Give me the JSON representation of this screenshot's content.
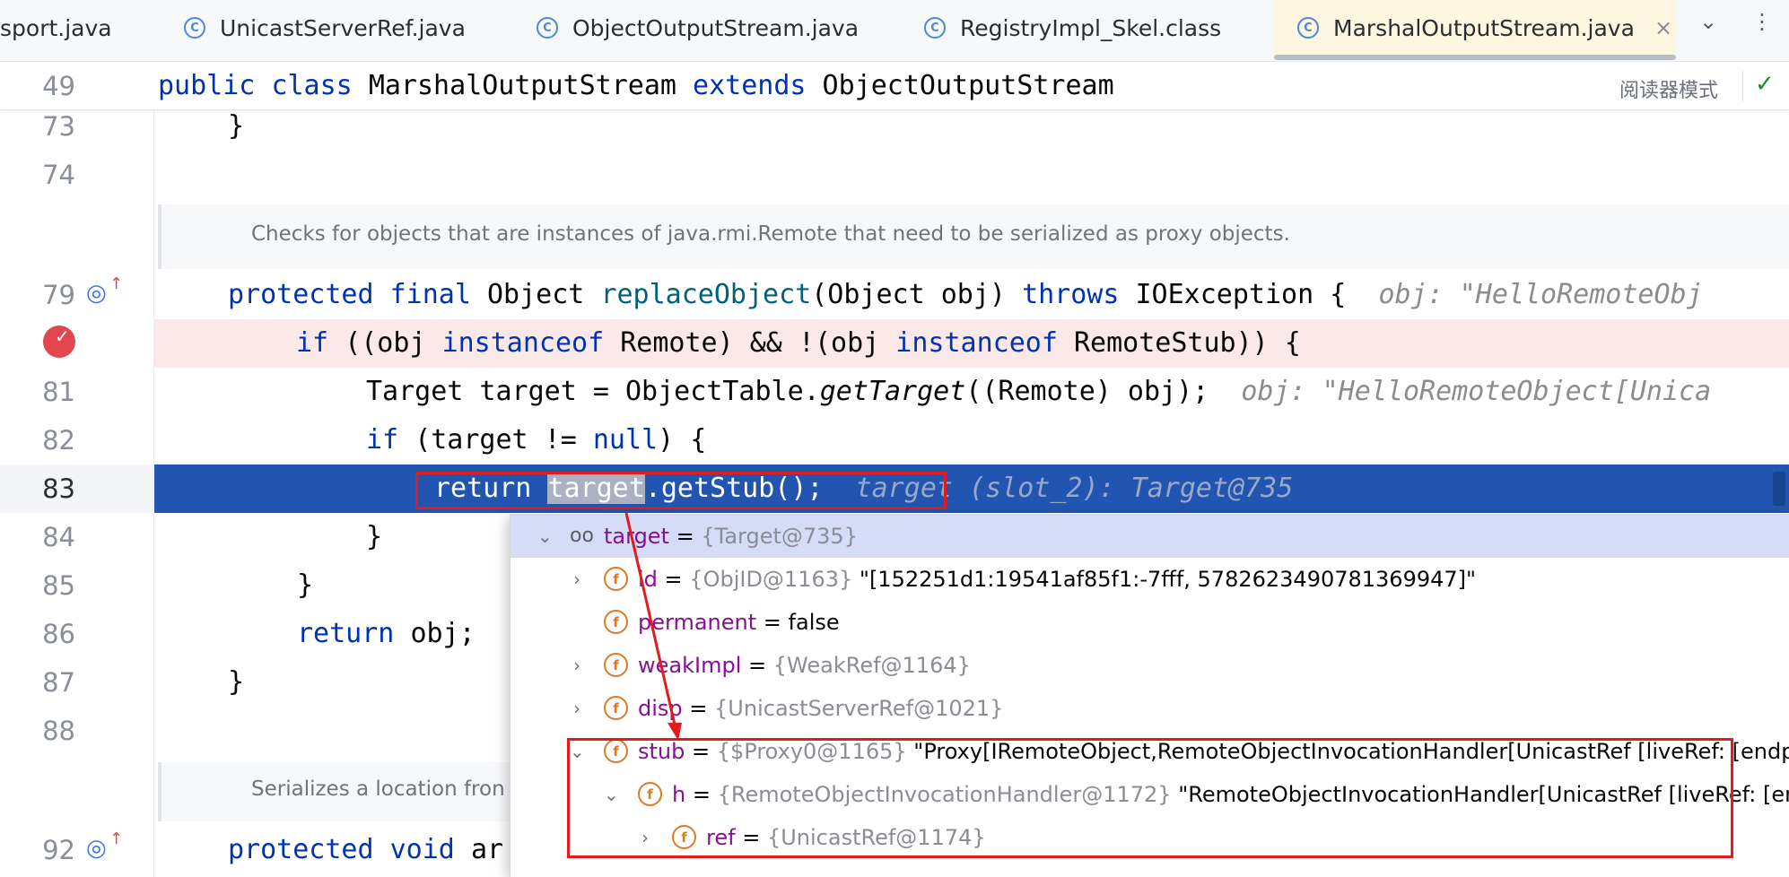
{
  "tabs": [
    {
      "label": "sport.java",
      "icon": "class-icon"
    },
    {
      "label": "UnicastServerRef.java",
      "icon": "class-icon"
    },
    {
      "label": "ObjectOutputStream.java",
      "icon": "class-icon"
    },
    {
      "label": "RegistryImpl_Skel.class",
      "icon": "class-icon"
    },
    {
      "label": "MarshalOutputStream.java",
      "icon": "class-icon",
      "active": true
    }
  ],
  "tab_close": "×",
  "reader_mode": "阅读器模式",
  "sticky": {
    "line": "49",
    "kw1": "public",
    "kw2": "class",
    "name": "MarshalOutputStream",
    "kw3": "extends",
    "parent": "ObjectOutputStream"
  },
  "lines": {
    "l73": "73",
    "l74": "74",
    "l79": "79",
    "l81": "81",
    "l82": "82",
    "l83": "83",
    "l84": "84",
    "l85": "85",
    "l86": "86",
    "l87": "87",
    "l88": "88",
    "l92": "92"
  },
  "code": {
    "c73": "}",
    "doc1": "Checks for objects that are instances of java.rmi.Remote that need to be serialized as proxy objects.",
    "c79_a": "protected",
    "c79_b": "final",
    "c79_c": "Object",
    "c79_d": "replaceObject",
    "c79_e": "(Object obj)",
    "c79_f": "throws",
    "c79_g": "IOException {",
    "c79_hint": "obj: \"HelloRemoteObj",
    "c80_a": "if",
    "c80_b": "((obj",
    "c80_c": "instanceof",
    "c80_d": "Remote) && !(obj",
    "c80_e": "instanceof",
    "c80_f": "RemoteStub)) {",
    "c81_a": "Target target = ObjectTable.",
    "c81_b": "getTarget",
    "c81_c": "((Remote) obj);",
    "c81_hint": "obj: \"HelloRemoteObject[Unica",
    "c82_a": "if",
    "c82_b": "(target !=",
    "c82_c": "null",
    "c82_d": ") {",
    "c83_a": "return",
    "c83_b": "target",
    "c83_c": ".getStub();",
    "c83_hint": "target (slot_2): Target@735",
    "c84": "}",
    "c85": "}",
    "c86_a": "return",
    "c86_b": "obj;",
    "c87": "}",
    "doc2": "Serializes a location fron",
    "c92_a": "protected",
    "c92_b": "void",
    "c92_c": "ar"
  },
  "popup": {
    "target_name": "target",
    "target_type": "{Target@735}",
    "id_name": "id",
    "id_type": "{ObjID@1163}",
    "id_value": "\"[152251d1:19541af85f1:-7fff, 5782623490781369947]\"",
    "perm_name": "permanent",
    "perm_value": "false",
    "weak_name": "weakImpl",
    "weak_type": "{WeakRef@1164}",
    "disp_name": "disp",
    "disp_type": "{UnicastServerRef@1021}",
    "stub_name": "stub",
    "stub_type": "{$Proxy0@1165}",
    "stub_value": "\"Proxy[IRemoteObject,RemoteObjectInvocationHandler[UnicastRef [liveRef: [endpo",
    "h_name": "h",
    "h_type": "{RemoteObjectInvocationHandler@1172}",
    "h_value": "\"RemoteObjectInvocationHandler[UnicastRef [liveRef: [end",
    "ref_name": "ref",
    "ref_type": "{UnicastRef@1174}",
    "eq": "="
  },
  "colors": {
    "keyword": "#0033b3",
    "exec_line": "#2155b0",
    "breakpoint": "#e0474e",
    "annotation_red": "#e21c1c"
  }
}
